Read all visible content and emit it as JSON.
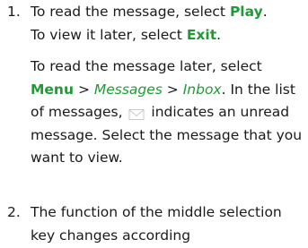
{
  "step1": {
    "number": "1.",
    "line1_prefix": "To read the message, select ",
    "play": "Play",
    "line1_suffix": ".",
    "line2_prefix": "To view it later, select ",
    "exit": "Exit",
    "line2_suffix": ".",
    "p2_a": "To read the message later, select ",
    "menu": "Menu",
    "sep1": " > ",
    "messages": "Messages",
    "sep2": " > ",
    "inbox": "Inbox",
    "p2_b": ". In the list of messages, ",
    "p2_c": " indicates an unread message. Select the message that you want to view."
  },
  "step2": {
    "number": "2.",
    "text": "The function of the middle selection key changes according"
  },
  "colors": {
    "text": "#1a1a1a",
    "accent": "#1f9a36"
  },
  "icons": {
    "unread": "envelope-icon"
  }
}
